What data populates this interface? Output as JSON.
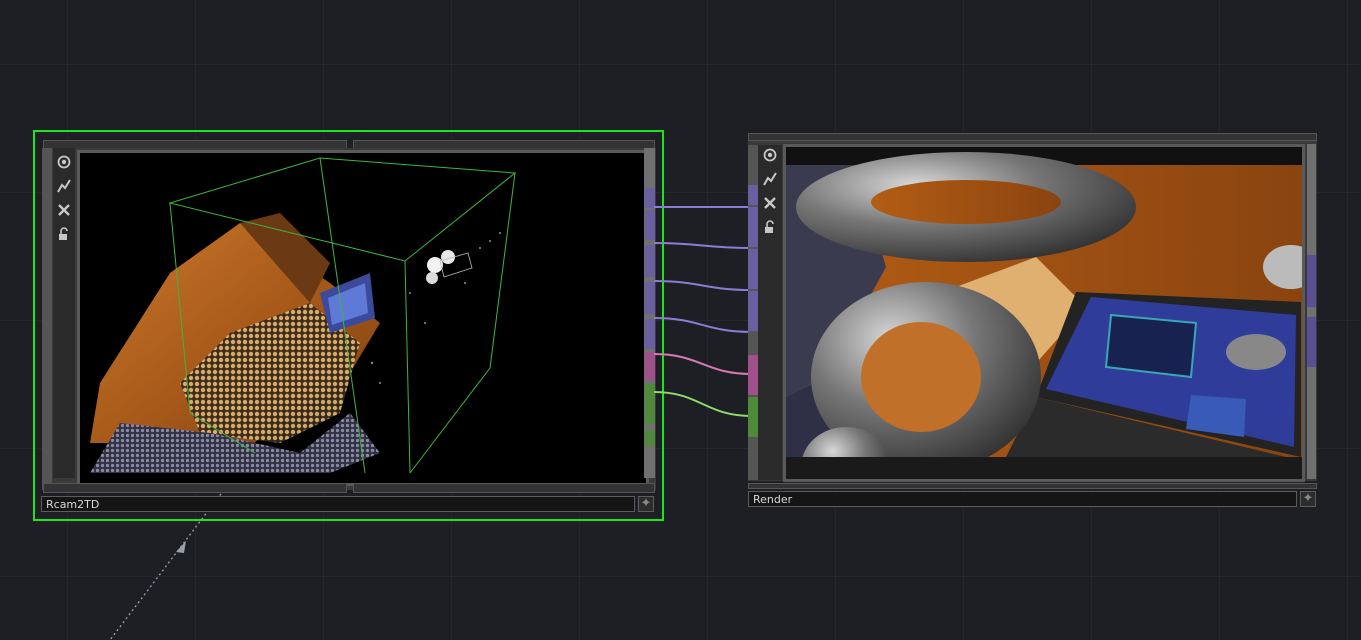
{
  "network": {
    "background": "#1e1f24",
    "grid_color": "#2a2b31"
  },
  "operators": [
    {
      "name": "Rcam2TD",
      "selected": true,
      "selection_color": "#1de51d",
      "viewer": "point-cloud-3d",
      "tools": [
        "viewer-icon",
        "bypass-icon",
        "close-icon",
        "lock-icon"
      ]
    },
    {
      "name": "Render",
      "selected": false,
      "viewer": "rendered-scene",
      "tools": [
        "viewer-icon",
        "bypass-icon",
        "close-icon",
        "lock-icon"
      ]
    }
  ],
  "wires": [
    {
      "from": "Rcam2TD",
      "to": "Render",
      "color": "#8b7dd6"
    },
    {
      "from": "Rcam2TD",
      "to": "Render",
      "color": "#8b7dd6"
    },
    {
      "from": "Rcam2TD",
      "to": "Render",
      "color": "#8b7dd6"
    },
    {
      "from": "Rcam2TD",
      "to": "Render",
      "color": "#8b7dd6"
    },
    {
      "from": "Rcam2TD",
      "to": "Render",
      "color": "#d679b4"
    },
    {
      "from": "Rcam2TD",
      "to": "Render",
      "color": "#8fd96a"
    }
  ],
  "port_colors": {
    "top": "#6a5fa0",
    "pink": "#a0508a",
    "green": "#4e8a3a",
    "render_right": "#5a4f95"
  }
}
